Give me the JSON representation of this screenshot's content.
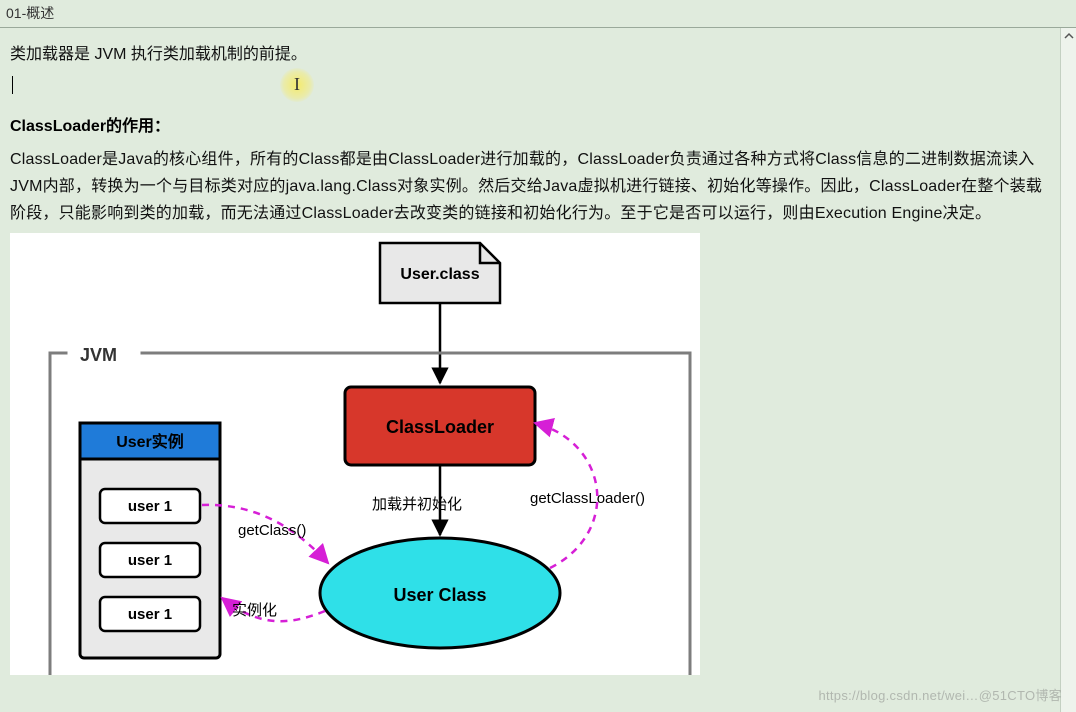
{
  "titlebar": "01-概述",
  "intro_line": "类加载器是 JVM 执行类加载机制的前提。",
  "section_heading": "ClassLoader的作用：",
  "body_paragraph": "ClassLoader是Java的核心组件，所有的Class都是由ClassLoader进行加载的，ClassLoader负责通过各种方式将Class信息的二进制数据流读入JVM内部，转换为一个与目标类对应的java.lang.Class对象实例。然后交给Java虚拟机进行链接、初始化等操作。因此，ClassLoader在整个装载阶段，只能影响到类的加载，而无法通过ClassLoader去改变类的链接和初始化行为。至于它是否可以运行，则由Execution Engine决定。",
  "diagram": {
    "file_box": "User.class",
    "jvm_label": "JVM",
    "instance_panel_title": "User实例",
    "instance_items": [
      "user 1",
      "user 1",
      "user 1"
    ],
    "classloader_box": "ClassLoader",
    "user_class_ellipse": "User  Class",
    "label_getClass": "getClass()",
    "label_instantiate": "实例化",
    "label_load_init": "加载并初始化",
    "label_getClassLoader": "getClassLoader()"
  },
  "watermark": "https://blog.csdn.net/wei…@51CTO博客"
}
